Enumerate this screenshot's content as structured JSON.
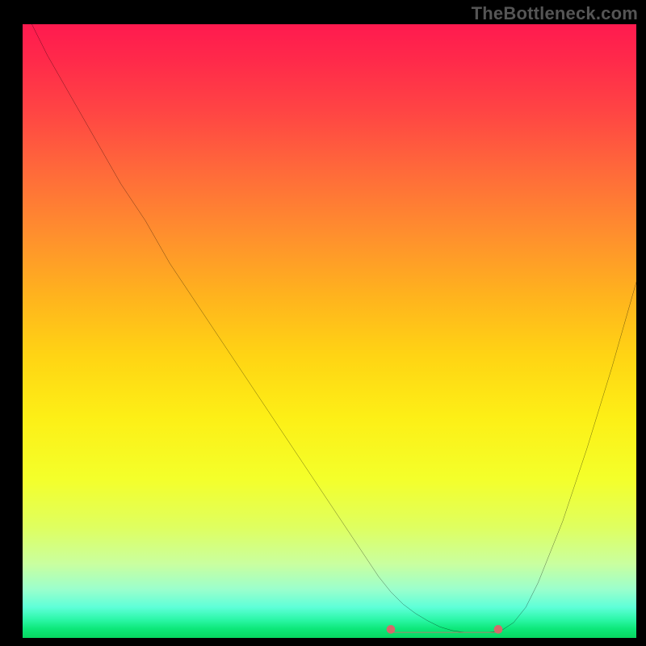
{
  "watermark": "TheBottleneck.com",
  "chart_data": {
    "type": "line",
    "title": "",
    "xlabel": "",
    "ylabel": "",
    "xlim": [
      0,
      100
    ],
    "ylim": [
      0,
      100
    ],
    "grid": false,
    "curve_color": "#000000",
    "flat_segment_color": "#d56a6a",
    "endpoint_marker_color": "#d56a6a",
    "x": [
      0,
      4,
      8,
      12,
      16,
      20,
      24,
      28,
      32,
      36,
      40,
      44,
      48,
      52,
      56,
      58,
      60,
      62,
      64,
      66,
      68,
      70,
      72,
      74,
      76,
      78,
      80,
      82,
      84,
      88,
      92,
      96,
      100
    ],
    "y": [
      103,
      95,
      88,
      81,
      74,
      68,
      61,
      55,
      49,
      43,
      37,
      31,
      25,
      19,
      13,
      10,
      7.5,
      5.5,
      4,
      2.8,
      1.8,
      1.2,
      0.9,
      0.9,
      0.9,
      1.2,
      2.5,
      5,
      9,
      19,
      31,
      44,
      58
    ],
    "flat_segment": {
      "x_start": 60,
      "x_end": 78,
      "y": 0.9
    },
    "flat_segment_markers": [
      {
        "x": 60,
        "y": 1.4
      },
      {
        "x": 77.5,
        "y": 1.4
      }
    ],
    "legend": false
  }
}
